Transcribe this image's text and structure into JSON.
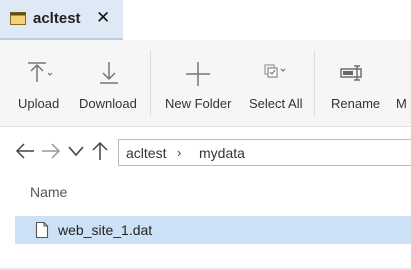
{
  "tab": {
    "title": "acltest",
    "close_glyph": "✕",
    "icon": "window-icon"
  },
  "toolbar": {
    "upload": {
      "label": "Upload",
      "icon": "upload-icon"
    },
    "download": {
      "label": "Download",
      "icon": "download-icon"
    },
    "new_folder": {
      "label": "New Folder",
      "icon": "plus-icon"
    },
    "select_all": {
      "label": "Select All",
      "icon": "select-all-icon"
    },
    "rename": {
      "label": "Rename",
      "icon": "rename-icon"
    },
    "more": {
      "label": "M",
      "icon": "more-icon"
    }
  },
  "navigation": {
    "back_icon": "arrow-left-icon",
    "forward_icon": "arrow-right-icon",
    "history_icon": "chevron-down-icon",
    "up_icon": "arrow-up-icon",
    "breadcrumb": [
      "acltest",
      "mydata"
    ],
    "separator": "›"
  },
  "list": {
    "column_header": "Name",
    "items": [
      {
        "name": "web_site_1.dat",
        "icon": "file-icon",
        "selected": true
      }
    ]
  },
  "colors": {
    "tab_bg": "#dfe9f6",
    "selection": "#cce0f6",
    "ribbon_bg": "#f6f6f6"
  }
}
